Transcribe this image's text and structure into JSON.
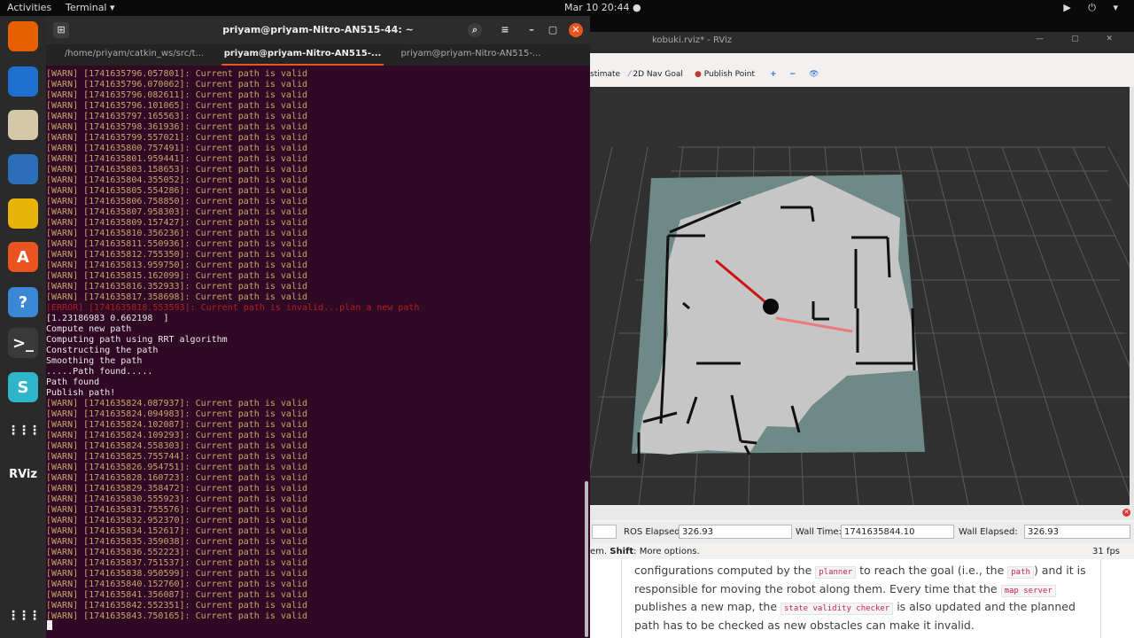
{
  "topbar": {
    "activities": "Activities",
    "app_menu": "Terminal ▾",
    "clock": "Mar 10  20:44  ●",
    "tray": "▶ ⏻ ▾"
  },
  "dock": {
    "items": [
      {
        "name": "firefox",
        "glyph": "",
        "color": "#e66000"
      },
      {
        "name": "thunderbird",
        "glyph": "",
        "color": "#1f6fd0"
      },
      {
        "name": "files",
        "glyph": "",
        "color": "#d4c8a8"
      },
      {
        "name": "libreoffice-writer",
        "glyph": "",
        "color": "#2a6fb8"
      },
      {
        "name": "rhythmbox",
        "glyph": "",
        "color": "#e8b40a"
      },
      {
        "name": "software",
        "glyph": "A",
        "color": "#e95420"
      },
      {
        "name": "help",
        "glyph": "?",
        "color": "#3a87d6"
      },
      {
        "name": "terminal",
        "glyph": ">_",
        "color": "#3a3a3a"
      },
      {
        "name": "app-s",
        "glyph": "S",
        "color": "#2fb5c9"
      },
      {
        "name": "show-apps",
        "glyph": "⋮⋮⋮",
        "color": "#2a2a2a"
      },
      {
        "name": "rviz",
        "glyph": "RViz",
        "color": "#2a2a2a"
      }
    ],
    "bottom_glyph": "⋮⋮⋮"
  },
  "terminal": {
    "window_title": "priyam@priyam-Nitro-AN515-44: ~",
    "tabs": [
      {
        "label": "/home/priyam/catkin_ws/src/t...",
        "active": false
      },
      {
        "label": "priyam@priyam-Nitro-AN515-...",
        "active": true
      },
      {
        "label": "priyam@priyam-Nitro-AN515-...",
        "active": false
      }
    ],
    "lines": [
      {
        "text": "[WARN] [1741635796.057801]: Current path is valid",
        "kind": "warn"
      },
      {
        "text": "[WARN] [1741635796.070062]: Current path is valid",
        "kind": "warn"
      },
      {
        "text": "[WARN] [1741635796.082611]: Current path is valid",
        "kind": "warn"
      },
      {
        "text": "[WARN] [1741635796.101065]: Current path is valid",
        "kind": "warn"
      },
      {
        "text": "[WARN] [1741635797.165563]: Current path is valid",
        "kind": "warn"
      },
      {
        "text": "[WARN] [1741635798.361936]: Current path is valid",
        "kind": "warn"
      },
      {
        "text": "[WARN] [1741635799.557021]: Current path is valid",
        "kind": "warn"
      },
      {
        "text": "[WARN] [1741635800.757491]: Current path is valid",
        "kind": "warn"
      },
      {
        "text": "[WARN] [1741635801.959441]: Current path is valid",
        "kind": "warn"
      },
      {
        "text": "[WARN] [1741635803.158653]: Current path is valid",
        "kind": "warn"
      },
      {
        "text": "[WARN] [1741635804.355052]: Current path is valid",
        "kind": "warn"
      },
      {
        "text": "[WARN] [1741635805.554286]: Current path is valid",
        "kind": "warn"
      },
      {
        "text": "[WARN] [1741635806.758850]: Current path is valid",
        "kind": "warn"
      },
      {
        "text": "[WARN] [1741635807.958303]: Current path is valid",
        "kind": "warn"
      },
      {
        "text": "[WARN] [1741635809.157427]: Current path is valid",
        "kind": "warn"
      },
      {
        "text": "[WARN] [1741635810.356236]: Current path is valid",
        "kind": "warn"
      },
      {
        "text": "[WARN] [1741635811.550936]: Current path is valid",
        "kind": "warn"
      },
      {
        "text": "[WARN] [1741635812.755350]: Current path is valid",
        "kind": "warn"
      },
      {
        "text": "[WARN] [1741635813.959750]: Current path is valid",
        "kind": "warn"
      },
      {
        "text": "[WARN] [1741635815.162099]: Current path is valid",
        "kind": "warn"
      },
      {
        "text": "[WARN] [1741635816.352933]: Current path is valid",
        "kind": "warn"
      },
      {
        "text": "[WARN] [1741635817.358698]: Current path is valid",
        "kind": "warn"
      },
      {
        "text": "[ERROR] [1741635818.553593]: Current path is invalid...plan a new path",
        "kind": "err"
      },
      {
        "text": "[1.23186983 0.662198  ]",
        "kind": "norm"
      },
      {
        "text": "Compute new path",
        "kind": "norm"
      },
      {
        "text": "Computing path using RRT algorithm",
        "kind": "norm"
      },
      {
        "text": "Constructing the path",
        "kind": "norm"
      },
      {
        "text": "Smoothing the path",
        "kind": "norm"
      },
      {
        "text": ".....Path found.....",
        "kind": "norm"
      },
      {
        "text": "Path found",
        "kind": "norm"
      },
      {
        "text": "Publish path!",
        "kind": "norm"
      },
      {
        "text": "[WARN] [1741635824.087937]: Current path is valid",
        "kind": "warn"
      },
      {
        "text": "[WARN] [1741635824.094983]: Current path is valid",
        "kind": "warn"
      },
      {
        "text": "[WARN] [1741635824.102087]: Current path is valid",
        "kind": "warn"
      },
      {
        "text": "[WARN] [1741635824.109293]: Current path is valid",
        "kind": "warn"
      },
      {
        "text": "[WARN] [1741635824.558303]: Current path is valid",
        "kind": "warn"
      },
      {
        "text": "[WARN] [1741635825.755744]: Current path is valid",
        "kind": "warn"
      },
      {
        "text": "[WARN] [1741635826.954751]: Current path is valid",
        "kind": "warn"
      },
      {
        "text": "[WARN] [1741635828.160723]: Current path is valid",
        "kind": "warn"
      },
      {
        "text": "[WARN] [1741635829.358472]: Current path is valid",
        "kind": "warn"
      },
      {
        "text": "[WARN] [1741635830.555923]: Current path is valid",
        "kind": "warn"
      },
      {
        "text": "[WARN] [1741635831.755576]: Current path is valid",
        "kind": "warn"
      },
      {
        "text": "[WARN] [1741635832.952370]: Current path is valid",
        "kind": "warn"
      },
      {
        "text": "[WARN] [1741635834.152617]: Current path is valid",
        "kind": "warn"
      },
      {
        "text": "[WARN] [1741635835.359038]: Current path is valid",
        "kind": "warn"
      },
      {
        "text": "[WARN] [1741635836.552223]: Current path is valid",
        "kind": "warn"
      },
      {
        "text": "[WARN] [1741635837.751537]: Current path is valid",
        "kind": "warn"
      },
      {
        "text": "[WARN] [1741635838.950599]: Current path is valid",
        "kind": "warn"
      },
      {
        "text": "[WARN] [1741635840.152760]: Current path is valid",
        "kind": "warn"
      },
      {
        "text": "[WARN] [1741635841.356087]: Current path is valid",
        "kind": "warn"
      },
      {
        "text": "[WARN] [1741635842.552351]: Current path is valid",
        "kind": "warn"
      },
      {
        "text": "[WARN] [1741635843.750165]: Current path is valid",
        "kind": "warn"
      }
    ]
  },
  "rviz": {
    "window_title": "kobuki.rviz* - RViz",
    "window_controls": "— ▢ ✕",
    "toolbar": {
      "estimate": "stimate",
      "nav_goal": "2D Nav Goal",
      "publish_point": "Publish Point",
      "zoom_plus": "+",
      "zoom_minus": "−",
      "eye": "👁"
    },
    "time_panel": {
      "ros_elapsed_label": "ROS Elapsed:",
      "ros_elapsed_value": "326.93",
      "wall_time_label": "Wall Time:",
      "wall_time_value": "1741635844.10",
      "wall_elapsed_label": "Wall Elapsed:",
      "wall_elapsed_value": "326.93"
    },
    "status": {
      "hint_prefix": "em. ",
      "hint_bold": "Shift",
      "hint_suffix": ": More options.",
      "fps": "31 fps"
    },
    "colors": {
      "map_free": "#c6c6c6",
      "map_unknown": "#6e8a86",
      "map_wall": "#111111",
      "arrow": "#cc1111",
      "path": "#ff6060"
    }
  },
  "doc": {
    "t1": "configurations computed by the ",
    "c1": "planner",
    "t2": " to reach the goal (i.e., the ",
    "c2": "path",
    "t3": ") and it is responsible for moving the robot along them. Every time that the ",
    "c3": "map server",
    "t4": " publishes a new map, the ",
    "c4": "state validity checker",
    "t5": " is also updated and the planned path has to be checked as new obstacles can make it invalid."
  }
}
